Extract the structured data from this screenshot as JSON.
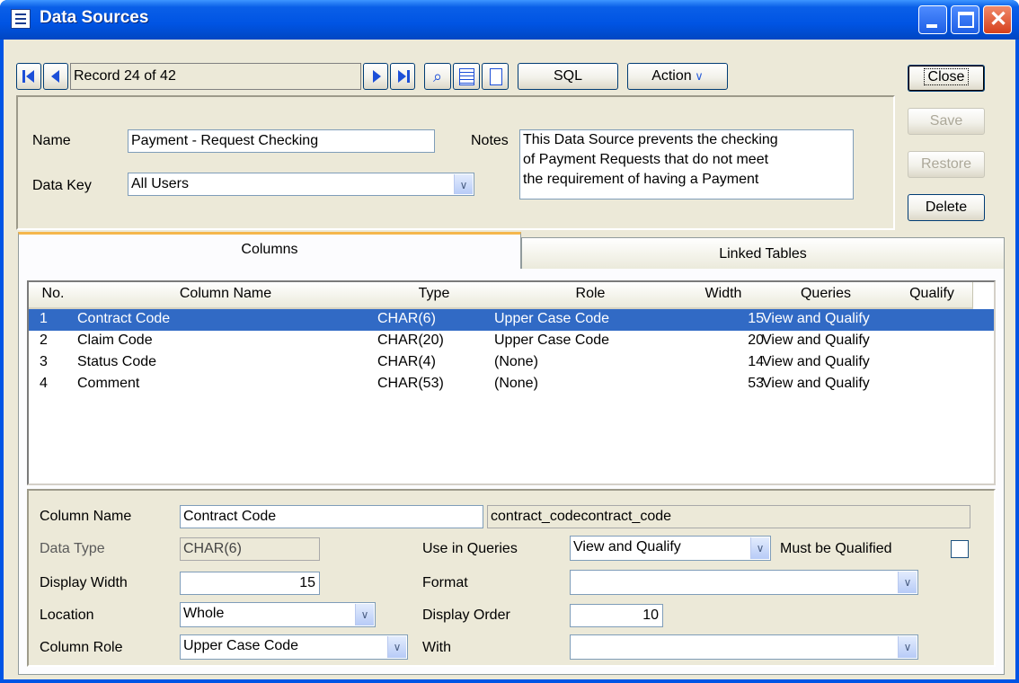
{
  "window": {
    "title": "Data Sources"
  },
  "toolbar": {
    "record_text": "Record 24 of 42",
    "sql_label": "SQL",
    "action_label": "Action",
    "close_label": "Close",
    "save_label": "Save",
    "restore_label": "Restore",
    "delete_label": "Delete"
  },
  "header": {
    "name_label": "Name",
    "name_value": "Payment - Request Checking",
    "datakey_label": "Data Key",
    "datakey_value": "All Users",
    "notes_label": "Notes",
    "notes_line1": "This Data Source prevents the checking",
    "notes_line2": "of Payment Requests that do not meet",
    "notes_line3": "the requirement of having a Payment"
  },
  "tabs": [
    {
      "label": "Columns",
      "active": true
    },
    {
      "label": "Linked Tables",
      "active": false
    }
  ],
  "grid": {
    "headers": [
      "No.",
      "Column Name",
      "Type",
      "Role",
      "Width",
      "Queries",
      "Qualify"
    ],
    "rows": [
      {
        "no": "1",
        "name": "Contract Code",
        "type": "CHAR(6)",
        "role": "Upper Case Code",
        "width": "15",
        "queries": "View and Qualify",
        "selected": true
      },
      {
        "no": "2",
        "name": "Claim Code",
        "type": "CHAR(20)",
        "role": "Upper Case Code",
        "width": "20",
        "queries": "View and Qualify",
        "selected": false
      },
      {
        "no": "3",
        "name": "Status Code",
        "type": "CHAR(4)",
        "role": "(None)",
        "width": "14",
        "queries": "View and Qualify",
        "selected": false
      },
      {
        "no": "4",
        "name": "Comment",
        "type": "CHAR(53)",
        "role": "(None)",
        "width": "53",
        "queries": "View and Qualify",
        "selected": false
      }
    ]
  },
  "detail": {
    "column_name_label": "Column Name",
    "column_name_value": "Contract Code",
    "db_name_value": "contract_codecontract_code",
    "data_type_label": "Data Type",
    "data_type_value": "CHAR(6)",
    "use_in_queries_label": "Use in Queries",
    "use_in_queries_value": "View and Qualify",
    "must_be_qualified_label": "Must be Qualified",
    "display_width_label": "Display Width",
    "display_width_value": "15",
    "format_label": "Format",
    "format_value": "",
    "location_label": "Location",
    "location_value": "Whole",
    "display_order_label": "Display Order",
    "display_order_value": "10",
    "column_role_label": "Column Role",
    "column_role_value": "Upper Case Code",
    "with_label": "With",
    "with_value": ""
  },
  "colors": {
    "title_bar": "#0054e3",
    "selection": "#316ac5",
    "face": "#ece9d8",
    "tab_accent": "#f5b74d"
  }
}
